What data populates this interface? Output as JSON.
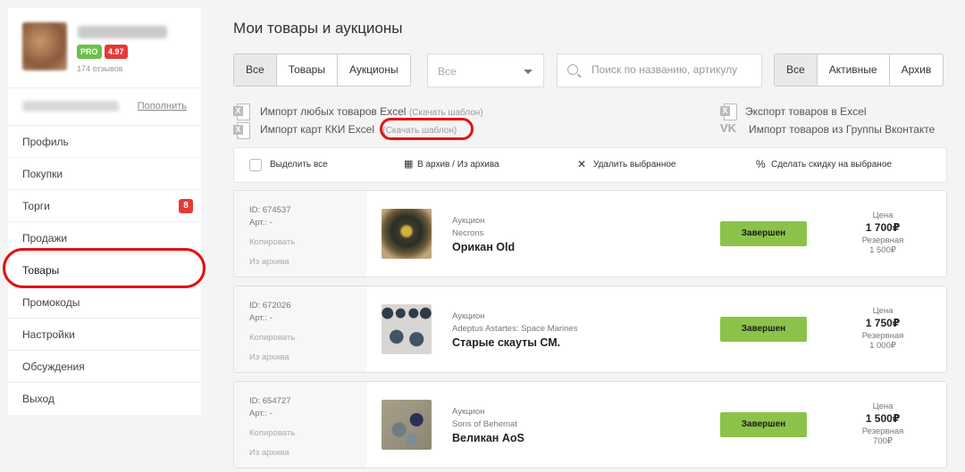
{
  "sidebar": {
    "badges": {
      "pro": "PRO",
      "rating": "4.97"
    },
    "reviews": "174 отзывов",
    "topup_label": "Пополнить",
    "menu": [
      {
        "label": "Профиль"
      },
      {
        "label": "Покупки"
      },
      {
        "label": "Торги",
        "badge": "8"
      },
      {
        "label": "Продажи"
      },
      {
        "label": "Товары",
        "active": true
      },
      {
        "label": "Промокоды"
      },
      {
        "label": "Настройки"
      },
      {
        "label": "Обсуждения"
      },
      {
        "label": "Выход"
      }
    ]
  },
  "main": {
    "title": "Мои товары и аукционы",
    "type_tabs": [
      "Все",
      "Товары",
      "Аукционы"
    ],
    "select_value": "Все",
    "search_placeholder": "Поиск по названию, артикулу",
    "status_tabs": [
      "Все",
      "Активные",
      "Архив"
    ],
    "import_any": "Импорт любых товаров Excel",
    "import_kki": "Импорт карт ККИ Excel",
    "download_template": "(Скачать шаблон)",
    "export_excel": "Экспорт товаров в Excel",
    "import_vk": "Импорт товаров из Группы Вконтакте"
  },
  "bulk": {
    "select_all": "Выделить все",
    "archive": "В архив / Из архива",
    "delete": "Удалить выбранное",
    "discount": "Сделать скидку на выбраное"
  },
  "items": [
    {
      "id": "ID: 674537",
      "art": "Арт.: -",
      "copy": "Копировать",
      "archive": "Из архива",
      "type": "Аукцион",
      "category": "Necrons",
      "name": "Орикан Old",
      "status": "Завершен",
      "price_label": "Цена",
      "price": "1 700₽",
      "reserve_label": "Резервная",
      "reserve": "1 500₽"
    },
    {
      "id": "ID: 672026",
      "art": "Арт.: -",
      "copy": "Копировать",
      "archive": "Из архива",
      "type": "Аукцион",
      "category": "Adeptus Astartes: Space Marines",
      "name": "Старые скауты СМ.",
      "status": "Завершен",
      "price_label": "Цена",
      "price": "1 750₽",
      "reserve_label": "Резервная",
      "reserve": "1 000₽"
    },
    {
      "id": "ID: 654727",
      "art": "Арт.: -",
      "copy": "Копировать",
      "archive": "Из архива",
      "type": "Аукцион",
      "category": "Sons of Behemat",
      "name": "Великан AoS",
      "status": "Завершен",
      "price_label": "Цена",
      "price": "1 500₽",
      "reserve_label": "Резервная",
      "reserve": "700₽"
    }
  ],
  "colors": {
    "accent_red": "#e53935",
    "status_green": "#8bc34a",
    "pro_green": "#6cc04a",
    "highlight_ring": "#e51010"
  }
}
